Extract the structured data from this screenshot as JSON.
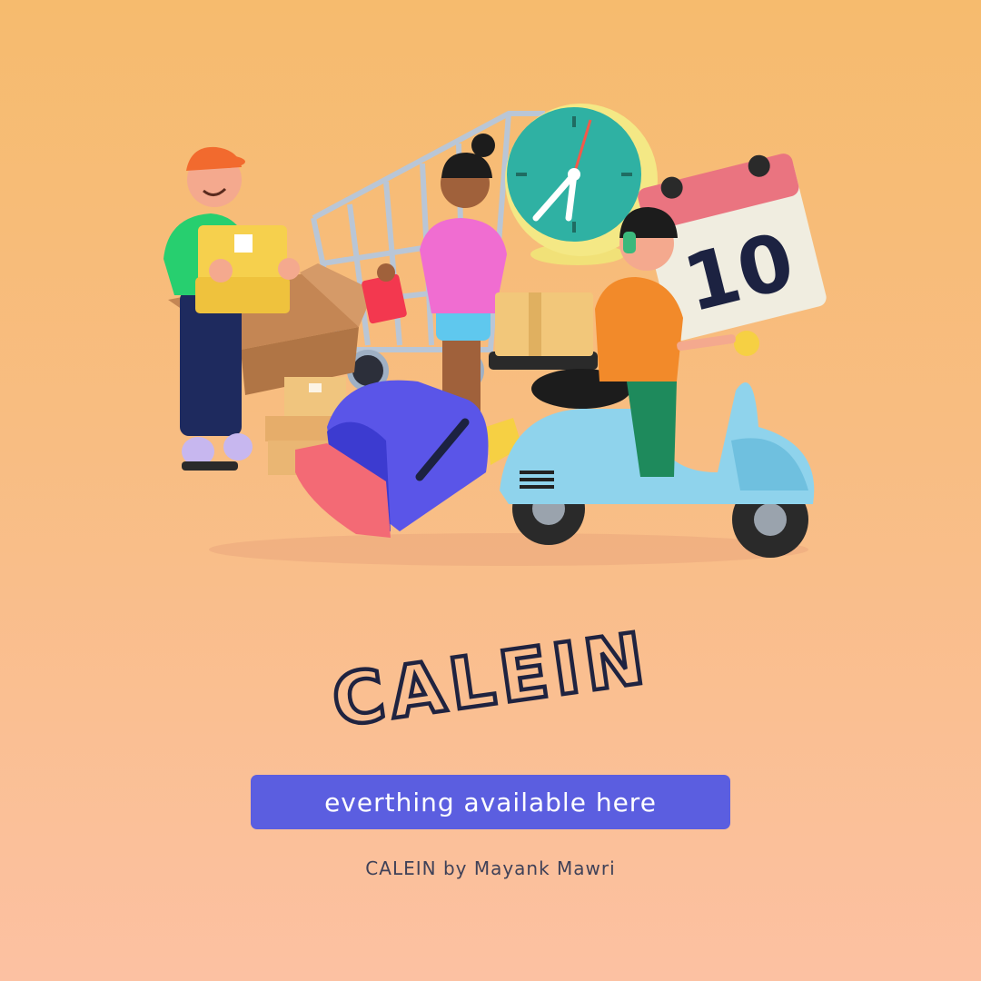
{
  "illustration": {
    "calendar_day": "10",
    "icons": [
      "delivery-man-icon",
      "shopping-cart-icon",
      "woman-with-clipboard-icon",
      "wall-clock-icon",
      "calendar-icon",
      "scooter-courier-icon",
      "mailbox-icon",
      "cardboard-box-icon"
    ]
  },
  "brand": {
    "title": "CALEIN"
  },
  "cta": {
    "label": "everthing available here"
  },
  "footer": {
    "credit": "CALEIN by Mayank Mawri"
  },
  "colors": {
    "background_top": "#f6bb6e",
    "background_bottom": "#fcc1a2",
    "title_stroke": "#1f2340",
    "button": "#5b5ee0",
    "button_text": "#ffffff",
    "credit_text": "#3f4158"
  }
}
